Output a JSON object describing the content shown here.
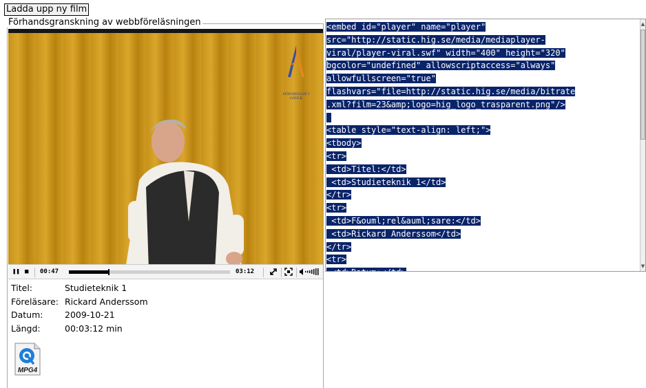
{
  "upload_button": {
    "label": "Ladda upp ny film"
  },
  "preview": {
    "legend": "Förhandsgranskning av webbföreläsningen",
    "logo_text": "HÖGSKOLAN I GÄVLE"
  },
  "player": {
    "elapsed": "00:47",
    "duration": "03:12",
    "progress": 0.245
  },
  "info": [
    {
      "label": "Titel:",
      "value": "Studieteknik 1"
    },
    {
      "label": "Föreläsare:",
      "value": "Rickard Anderssom"
    },
    {
      "label": "Datum:",
      "value": "2009-10-21"
    },
    {
      "label": "Längd:",
      "value": "00:03:12 min"
    }
  ],
  "download": {
    "label": "MPG4",
    "icon": "quicktime-icon"
  },
  "code": {
    "lines": [
      "<embed id=\"player\" name=\"player\"",
      "src=\"http://static.hig.se/media/mediaplayer-",
      "viral/player-viral.swf\" width=\"400\" height=\"320\"",
      "bgcolor=\"undefined\" allowscriptaccess=\"always\"",
      "allowfullscreen=\"true\"",
      "flashvars=\"file=http://static.hig.se/media/bitrate",
      ".xml?film=23&amp;logo=hig_logo_trasparent.png\"/>",
      " ",
      "<table style=\"text-align: left;\">",
      "<tbody>",
      "<tr>",
      " <td>Titel:</td>",
      " <td>Studieteknik 1</td>",
      "</tr>",
      "<tr>",
      " <td>F&ouml;rel&auml;sare:</td>",
      " <td>Rickard Anderssom</td>",
      "</tr>",
      "<tr>",
      " <td>Datum:</td>"
    ]
  },
  "colors": {
    "selection_bg": "#0a246a",
    "selection_fg": "#ffffff",
    "curtain": "#c69013"
  }
}
